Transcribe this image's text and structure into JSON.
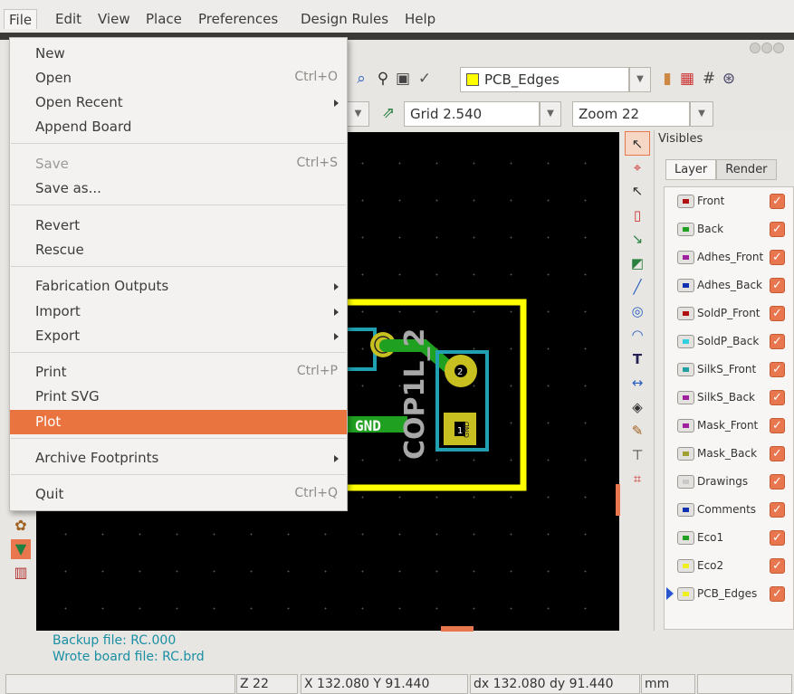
{
  "menubar": {
    "items": [
      "File",
      "Edit",
      "View",
      "Place",
      "Preferences",
      "Design Rules",
      "Help"
    ]
  },
  "file_menu": {
    "items": [
      {
        "label": "New",
        "shortcut": ""
      },
      {
        "label": "Open",
        "shortcut": "Ctrl+O"
      },
      {
        "label": "Open Recent",
        "shortcut": ""
      },
      {
        "label": "Append Board",
        "shortcut": ""
      },
      {
        "label": "Save",
        "shortcut": "Ctrl+S"
      },
      {
        "label": "Save as...",
        "shortcut": ""
      },
      {
        "label": "Revert",
        "shortcut": ""
      },
      {
        "label": "Rescue",
        "shortcut": ""
      },
      {
        "label": "Fabrication Outputs",
        "shortcut": ""
      },
      {
        "label": "Import",
        "shortcut": ""
      },
      {
        "label": "Export",
        "shortcut": ""
      },
      {
        "label": "Print",
        "shortcut": "Ctrl+P"
      },
      {
        "label": "Print SVG",
        "shortcut": ""
      },
      {
        "label": "Plot",
        "shortcut": ""
      },
      {
        "label": "Archive Footprints",
        "shortcut": ""
      },
      {
        "label": "Quit",
        "shortcut": "Ctrl+Q"
      }
    ],
    "highlighted": "Plot",
    "disabled": [
      "Save"
    ]
  },
  "toolbar": {
    "layer_select": "PCB_Edges",
    "layer_color": "#ffff00",
    "grid_select": "Grid 2.540",
    "zoom_select": "Zoom 22"
  },
  "visibles": {
    "title": "Visibles",
    "tabs": [
      "Layer",
      "Render"
    ],
    "active_tab": "Layer",
    "layers": [
      {
        "name": "Front",
        "color": "#b01010",
        "checked": true
      },
      {
        "name": "Back",
        "color": "#20a020",
        "checked": true
      },
      {
        "name": "Adhes_Front",
        "color": "#a020a0",
        "checked": true
      },
      {
        "name": "Adhes_Back",
        "color": "#1030b0",
        "checked": true
      },
      {
        "name": "SoldP_Front",
        "color": "#b01010",
        "checked": true
      },
      {
        "name": "SoldP_Back",
        "color": "#30d0e0",
        "checked": true
      },
      {
        "name": "SilkS_Front",
        "color": "#20a0a0",
        "checked": true
      },
      {
        "name": "SilkS_Back",
        "color": "#a020a0",
        "checked": true
      },
      {
        "name": "Mask_Front",
        "color": "#a020a0",
        "checked": true
      },
      {
        "name": "Mask_Back",
        "color": "#a0a030",
        "checked": true
      },
      {
        "name": "Drawings",
        "color": "#c8c8c8",
        "checked": true
      },
      {
        "name": "Comments",
        "color": "#1030b0",
        "checked": true
      },
      {
        "name": "Eco1",
        "color": "#20a020",
        "checked": true
      },
      {
        "name": "Eco2",
        "color": "#f0f020",
        "checked": true
      },
      {
        "name": "PCB_Edges",
        "color": "#f0f020",
        "checked": true,
        "active": true
      }
    ]
  },
  "board": {
    "net_label": "GND",
    "ref_label": "COP1L_2",
    "pad1_label": "1",
    "pad1_net": "GND",
    "pad2_label": "2",
    "pad_small_label": "2"
  },
  "messages": [
    "Backup file: RC.000",
    "Wrote board file: RC.brd"
  ],
  "status": {
    "zoom": "Z 22",
    "xy": "X 132.080  Y 91.440",
    "dxdy": "dx 132.080  dy 91.440",
    "units": "mm"
  },
  "colors": {
    "accent": "#e9743f",
    "canvas": "#000000",
    "edge": "#ffff00",
    "track": "#20a020",
    "pad": "#c8c020",
    "outline": "#20a0b0"
  }
}
